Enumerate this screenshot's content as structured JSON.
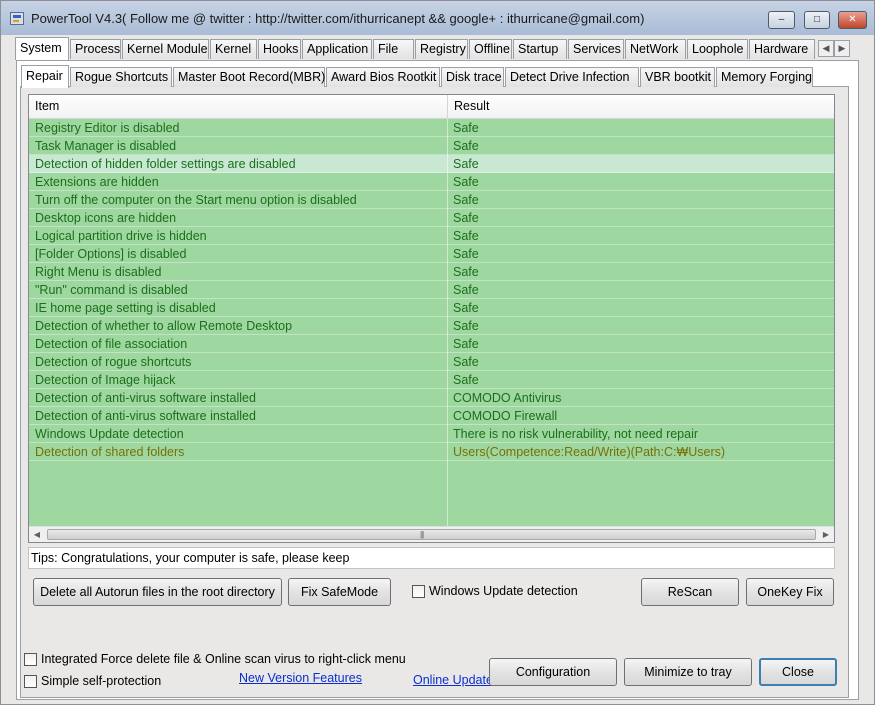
{
  "window": {
    "title": "PowerTool V4.3( Follow me @ twitter : http://twitter.com/ithurricanept && google+ : ithurricane@gmail.com)",
    "controls": {
      "minimize": "–",
      "maximize": "□",
      "close": "✕"
    }
  },
  "main_tabs": [
    "System",
    "Process",
    "Kernel Module",
    "Kernel",
    "Hooks",
    "Application",
    "File",
    "Registry",
    "Offline",
    "Startup",
    "Services",
    "NetWork",
    "Loophole",
    "Hardware"
  ],
  "main_tab_scroll": {
    "left": "◀",
    "right": "▶"
  },
  "sub_tabs": [
    "Repair",
    "Rogue Shortcuts",
    "Master Boot Record(MBR)",
    "Award Bios Rootkit",
    "Disk trace",
    "Detect Drive Infection",
    "VBR bootkit",
    "Memory Forging"
  ],
  "list": {
    "columns": [
      "Item",
      "Result"
    ],
    "rows": [
      {
        "item": "Registry Editor is disabled",
        "result": "Safe"
      },
      {
        "item": "Task Manager is disabled",
        "result": "Safe"
      },
      {
        "item": "Detection of hidden folder settings are disabled",
        "result": "Safe"
      },
      {
        "item": "Extensions are hidden",
        "result": "Safe"
      },
      {
        "item": "Turn off the computer on the Start menu option is disabled",
        "result": "Safe"
      },
      {
        "item": "Desktop icons are hidden",
        "result": "Safe"
      },
      {
        "item": "Logical partition drive is hidden",
        "result": "Safe"
      },
      {
        "item": "[Folder Options] is disabled",
        "result": "Safe"
      },
      {
        "item": "Right Menu is disabled",
        "result": "Safe"
      },
      {
        "item": "\"Run\" command is disabled",
        "result": "Safe"
      },
      {
        "item": "IE home page setting is disabled",
        "result": "Safe"
      },
      {
        "item": "Detection of whether to allow Remote Desktop",
        "result": "Safe"
      },
      {
        "item": "Detection of file association",
        "result": "Safe"
      },
      {
        "item": "Detection of rogue shortcuts",
        "result": "Safe"
      },
      {
        "item": "Detection of Image hijack",
        "result": "Safe"
      },
      {
        "item": "Detection of anti-virus software installed",
        "result": "COMODO Antivirus"
      },
      {
        "item": "Detection of anti-virus software installed",
        "result": "COMODO Firewall"
      },
      {
        "item": "Windows Update detection",
        "result": "There is no risk vulnerability, not need repair"
      },
      {
        "item": "Detection of shared folders",
        "result": "Users(Competence:Read/Write)(Path:C:₩Users)"
      }
    ],
    "scroll": {
      "left": "◀",
      "right": "▶",
      "grip": "|||"
    }
  },
  "tips": "Tips: Congratulations, your computer is safe, please keep",
  "buttons": {
    "delete_autorun": "Delete all Autorun files in the root directory",
    "fix_safemode": "Fix SafeMode",
    "rescan": "ReScan",
    "onekey_fix": "OneKey Fix",
    "configuration": "Configuration",
    "minimize_tray": "Minimize to tray",
    "close": "Close"
  },
  "checkboxes": {
    "windows_update": "Windows Update detection",
    "integrated_force": "Integrated Force delete file & Online scan virus to right-click menu",
    "self_protection": "Simple self-protection"
  },
  "links": {
    "new_features": "New Version Features",
    "online_update": "Online Update"
  },
  "colors": {
    "list_bg": "#9fd7a0",
    "safe_text": "#1a6f1a",
    "warn_text": "#77700a",
    "link": "#0a2fd1"
  }
}
